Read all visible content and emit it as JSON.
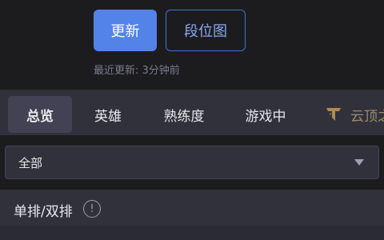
{
  "header": {
    "update_button": "更新",
    "tier_graph_button": "段位图",
    "last_update": "最近更新: 3分钟前"
  },
  "tabs": [
    {
      "label": "总览",
      "active": true
    },
    {
      "label": "英雄",
      "active": false
    },
    {
      "label": "熟练度",
      "active": false
    },
    {
      "label": "游戏中",
      "active": false
    },
    {
      "label": "云顶之",
      "active": false,
      "icon": "tft-icon"
    }
  ],
  "filter": {
    "selected": "全部"
  },
  "queue": {
    "label": "单排/双排",
    "icon": "info-icon"
  },
  "colors": {
    "accent": "#5383e8",
    "background": "#1c1c1f",
    "panel": "#31313c",
    "tft_gold": "#9e8c6a"
  }
}
